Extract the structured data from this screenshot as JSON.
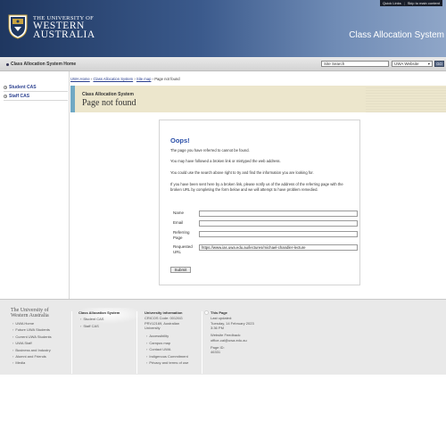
{
  "header": {
    "quick_links": "Quick Links",
    "skip_link": "Skip to main content",
    "uni_the": "THE UNIVERSITY OF",
    "uni_line1": "WESTERN",
    "uni_line2": "AUSTRALIA",
    "site_title": "Class Allocation System"
  },
  "nav": {
    "home_label": "Class Allocation System Home",
    "search_placeholder": "Site Search",
    "search_scope": "UWA Website",
    "go_label": "GO"
  },
  "sidebar": {
    "items": [
      {
        "label": "Student CAS"
      },
      {
        "label": "Staff CAS"
      }
    ]
  },
  "breadcrumb": {
    "items": [
      "UWA Home",
      "Class Allocation System",
      "Site map"
    ],
    "separator": "›",
    "current": "Page not found"
  },
  "page": {
    "system_name": "Class Allocation System",
    "title": "Page not found"
  },
  "error": {
    "heading": "Oops!",
    "msg1": "The page you have referred to cannot be found.",
    "msg2": "You may have followed a broken link or mistyped the web address.",
    "msg3": "You could use the search above right to try and find the information you are looking for.",
    "msg4": "If you have been sent here by a broken link, please notify us of the address of the referring page with the broken URL by completing the form below and we will attempt to have problem remedied.",
    "form": {
      "name_label": "Name",
      "email_label": "Email",
      "referring_label": "Referring Page",
      "requested_label": "Requested URL",
      "requested_value": "https://www.ias.uwa.edu.au/lectures/michael-chandler-lecture",
      "submit_label": "Submit"
    }
  },
  "footer": {
    "uni_line1": "The University of",
    "uni_line2": "Western Australia",
    "uni_links": [
      "UWA Home",
      "Future UWA Students",
      "Current UWA Students",
      "UWA Staff",
      "Business and Industry",
      "Alumni and Friends",
      "Media"
    ],
    "cas_heading": "Class Allocation System",
    "cas_links": [
      "Student CAS",
      "Staff CAS"
    ],
    "info_heading": "University information",
    "info_lines": [
      "CRICOS Code: 00126G",
      "PRV12169, Australian",
      "University"
    ],
    "info_links": [
      "Accessibility",
      "Campus map",
      "Contact UWA",
      "Indigenous Commitment",
      "Privacy and terms of use"
    ],
    "page_heading": "This Page",
    "last_updated_label": "Last updated:",
    "last_updated_value": "Tuesday, 14 February 2023",
    "last_updated_time": "3:36 PM",
    "feedback_label": "Website Feedback:",
    "feedback_value": "office-cal@uwa.edu.au",
    "page_id_label": "Page ID:",
    "page_id_value": "46331"
  },
  "colors": {
    "header_dark": "#1f3760",
    "header_light": "#8fa6c8",
    "link_blue": "#2a3f8f",
    "heading_blue": "#2a4fa8",
    "title_band": "#ece6cc",
    "title_accent": "#70a9c4"
  }
}
